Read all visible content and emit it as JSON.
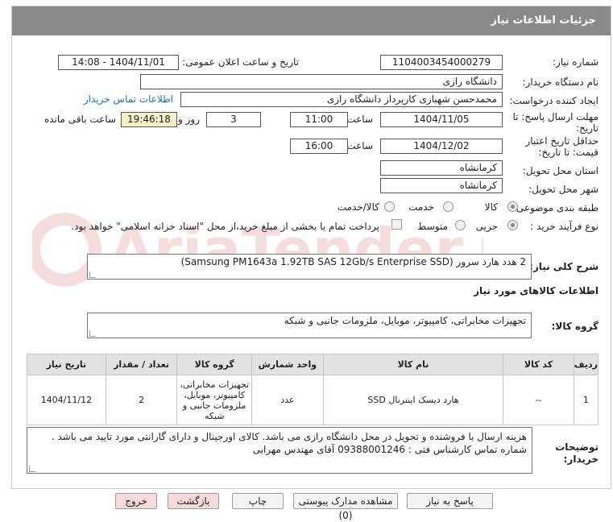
{
  "header": {
    "title": "جزئیات اطلاعات نیاز"
  },
  "fields": {
    "need_number_label": "شماره نیاز:",
    "need_number": "1104003454000279",
    "announce_label": "تاریخ و ساعت اعلان عمومی:",
    "announce_value": "1404/11/01 - 14:08",
    "buyer_org_label": "نام دستگاه خریدار:",
    "buyer_org": "دانشگاه رازی",
    "creator_label": "ایجاد کننده درخواست:",
    "creator": "محمدحسن شهبازی کارپرداز دانشگاه رازی",
    "contact_link": "اطلاعات تماس خریدار",
    "deadline_label_1": "مهلت ارسال پاسخ: تا",
    "deadline_label_2": "تاریخ:",
    "deadline_date": "1404/11/05",
    "hour_label": "ساعت",
    "deadline_time": "11:00",
    "days_value": "3",
    "days_label": "روز و",
    "remaining_time": "19:46:18",
    "remaining_label": "ساعت باقی مانده",
    "validity_label_1": "حداقل تاریخ اعتبار",
    "validity_label_2": "قیمت: تا تاریخ:",
    "validity_date": "1404/12/02",
    "validity_time": "16:00",
    "province_label": "استان محل تحویل:",
    "province": "کرمانشاه",
    "city_label": "شهر محل تحویل:",
    "city": "کرمانشاه",
    "category_label": "طبقه بندی موضوعی:",
    "category_options": [
      "کالا",
      "خدمت",
      "کالا/خدمت"
    ],
    "process_label": "نوع فرآیند خرید :",
    "process_options": [
      "جزیی",
      "متوسط"
    ],
    "payment_note": "پرداخت تمام یا بخشی از مبلغ خرید،از محل \"اسناد خزانه اسلامی\" خواهد بود."
  },
  "summary": {
    "label": "شرح کلی نیاز:",
    "value": "2 هدد هارد سرور (Samsung PM1643a 1.92TB SAS 12Gb/s Enterprise SSD)"
  },
  "goods_info_title": "اطلاعات کالاهای مورد نیاز",
  "goods_group": {
    "label": "گروه کالا:",
    "value": "تجهیزات مخابراتی، کامپیوتر، موبایل، ملزومات جانبی و شبکه"
  },
  "table": {
    "headers": [
      "ردیف",
      "کد کالا",
      "نام کالا",
      "واحد شمارش",
      "گروه کالا",
      "تعداد / مقدار",
      "تاریخ نیاز"
    ],
    "rows": [
      {
        "row": "1",
        "code": "--",
        "name": "هارد دیسک اینترنال SSD",
        "unit": "عدد",
        "group": "تجهیزات مخابراتی، کامپیوتر، موبایل، ملزومات جانبی و شبکه",
        "qty": "2",
        "date": "1404/11/12"
      }
    ]
  },
  "notes": {
    "label_1": "توضیحات",
    "label_2": "خریدار:",
    "line1": "هزینه ارسال با فروشنده و تحویل در محل دانشگاه رازی می باشد. کالای اورجینال و دارای گارانتی مورد تایید می باشد .",
    "line2": "شماره تماس کارشناس فنی : 09388001246 آقای مهندس مهرابی"
  },
  "buttons": {
    "reply": "پاسخ به نیاز",
    "docs": "مشاهده مدارک پیوستی (0)",
    "print": "چاپ",
    "back": "بازگشت",
    "exit": "خروج"
  },
  "watermark_text": "AriaTender.neT"
}
